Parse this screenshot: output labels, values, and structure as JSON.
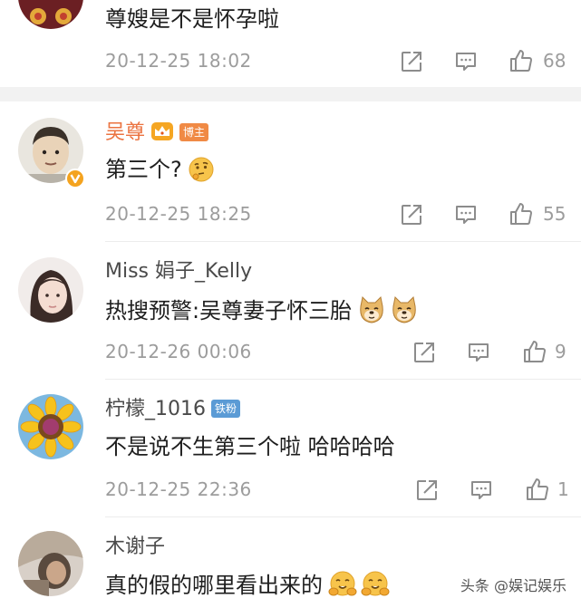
{
  "comments": [
    {
      "user": "",
      "text": "尊嫂是不是怀孕啦",
      "time": "20-12-25 18:02",
      "likes": "68"
    },
    {
      "user": "吴尊",
      "badge": "博主",
      "text": "第三个?",
      "time": "20-12-25 18:25",
      "likes": "55"
    },
    {
      "user": "Miss 娟子_Kelly",
      "text": "热搜预警:吴尊妻子怀三胎",
      "time": "20-12-26 00:06",
      "likes": "9"
    },
    {
      "user": "柠檬_1016",
      "badge": "铁粉",
      "text": "不是说不生第三个啦 哈哈哈哈",
      "time": "20-12-25 22:36",
      "likes": "1"
    },
    {
      "user": "木谢子",
      "text": "真的假的哪里看出来的",
      "time": "",
      "likes": ""
    }
  ],
  "watermark": "头条 @娱记娱乐",
  "icons": [
    "share-icon",
    "comment-icon",
    "like-icon",
    "thinking-emoji",
    "doge-emoji",
    "hugging-emoji",
    "crown-icon",
    "verified-icon"
  ],
  "colors": {
    "username_highlight": "#eb7340",
    "meta_gray": "#9c9c9c",
    "blogger_badge": "#f08a45",
    "fan_badge": "#5b9bd5"
  }
}
